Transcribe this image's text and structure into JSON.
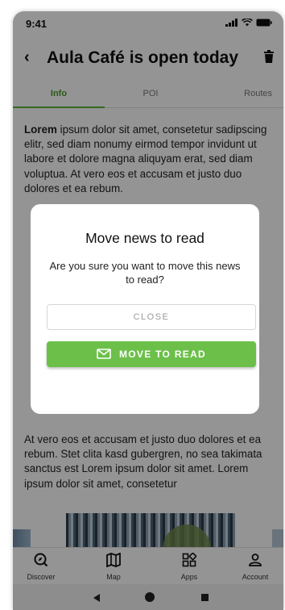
{
  "status_bar": {
    "time": "9:41"
  },
  "app_bar": {
    "title": "Aula Café is open today"
  },
  "tabs": [
    {
      "label": "Info",
      "active": true
    },
    {
      "label": "POI",
      "active": false
    },
    {
      "label": "Routes",
      "active": false
    }
  ],
  "article": {
    "lead_bold": "Lorem",
    "paragraph1_rest": " ipsum dolor sit amet, consetetur sadipscing elitr, sed diam nonumy eirmod tempor invidunt ut labore et dolore magna aliquyam erat, sed diam voluptua. At vero eos et accusam et justo duo dolores et ea rebum.",
    "paragraph2": "At vero eos et accusam et justo duo dolores et ea rebum. Stet clita kasd gubergren, no sea takimata sanctus est Lorem ipsum dolor sit amet. Lorem ipsum dolor sit amet, consetetur"
  },
  "dialog": {
    "title": "Move news to read",
    "message": "Are you sure you want to move this news to read?",
    "close_label": "CLOSE",
    "confirm_label": "MOVE TO READ",
    "confirm_icon": "mail-icon"
  },
  "bottom_nav": [
    {
      "label": "Discover",
      "icon": "discover-icon"
    },
    {
      "label": "Map",
      "icon": "map-icon"
    },
    {
      "label": "Apps",
      "icon": "apps-icon"
    },
    {
      "label": "Account",
      "icon": "account-icon"
    }
  ],
  "colors": {
    "accent": "#6cc04a",
    "accent_text": "#4a9a2a",
    "scrim": "rgba(0,0,0,0.42)"
  }
}
